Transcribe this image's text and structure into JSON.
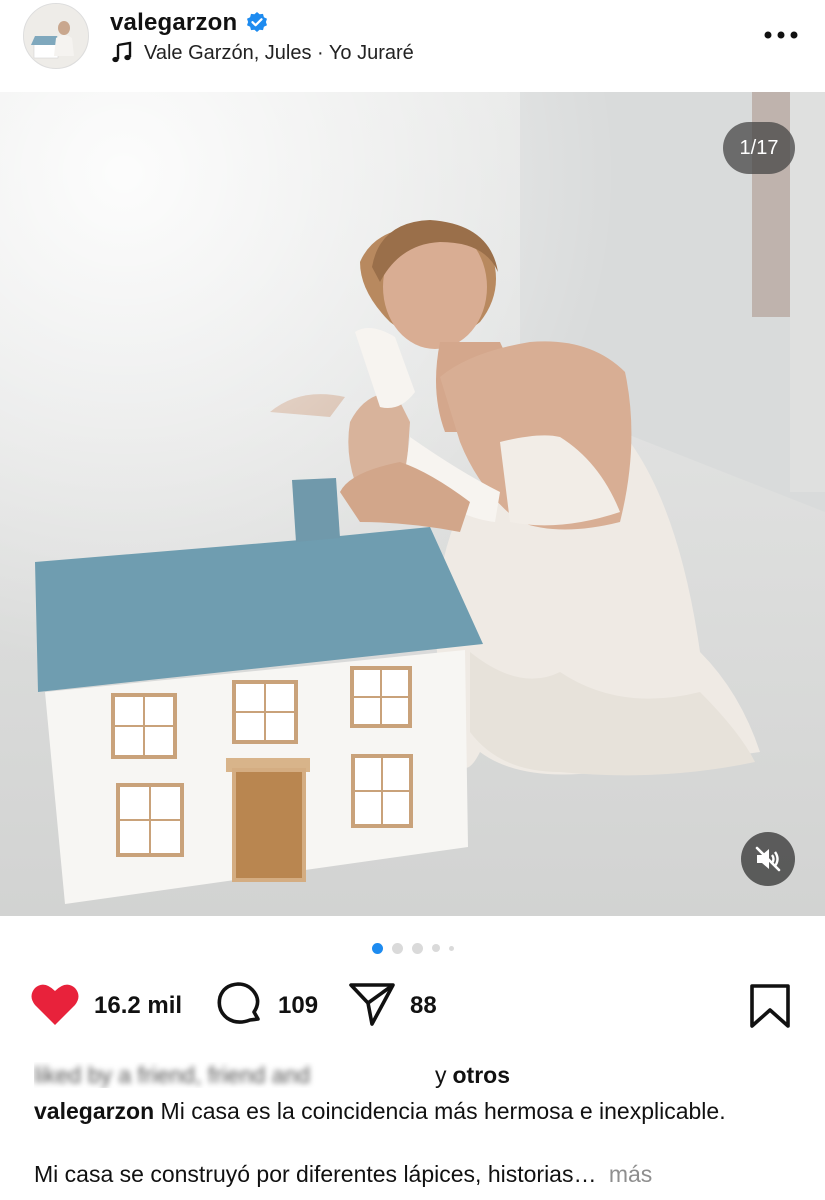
{
  "post": {
    "username": "valegarzon",
    "music": "Vale Garzón, Jules · Yo Juraré",
    "counter": "1/17",
    "likes": "16.2 mil",
    "comments": "109",
    "shares": "88",
    "likers_blurred": "liked by a friend, friend and",
    "likers_and": "y",
    "likers_others": "otros",
    "caption_user": "valegarzon",
    "caption_text": "Mi casa es la coincidencia más hermosa e inexplicable.",
    "caption_line2": "Mi casa se construyó por diferentes lápices, historias…",
    "more_label": "más"
  },
  "colors": {
    "heart": "#e8223b",
    "verified": "#1d8bf0",
    "active_dot": "#1d8bf0"
  },
  "icons": [
    "verified-badge-icon",
    "music-note-icon",
    "more-options-icon",
    "mute-icon",
    "heart-icon",
    "comment-icon",
    "share-icon",
    "save-icon"
  ]
}
